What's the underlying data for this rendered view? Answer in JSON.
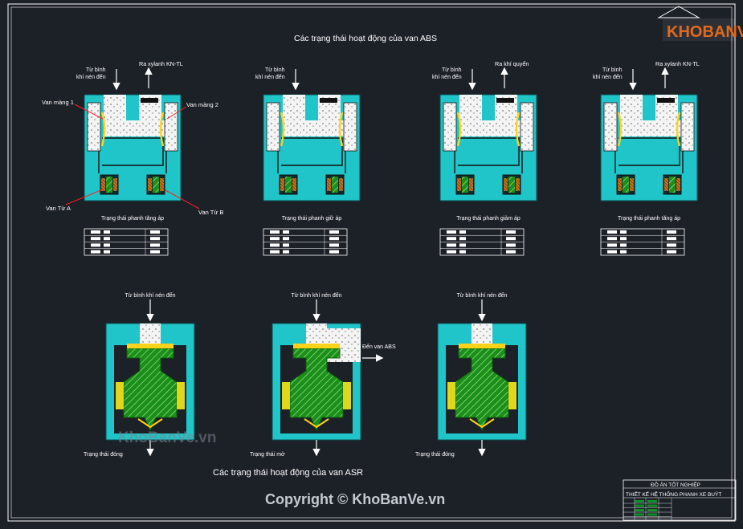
{
  "titles": {
    "abs": "Các trạng thái hoạt động của van ABS",
    "asr": "Các trạng thái hoạt động của van ASR"
  },
  "logo": {
    "text": "KHOBANVE"
  },
  "watermark": {
    "site": "KhoBanVe.vn"
  },
  "copyright": "Copyright © KhoBanVe.vn",
  "abs": {
    "inlet_label_1": "Từ bình",
    "inlet_label_2": "khí nén đến",
    "diagrams": [
      {
        "outlet": "Ra xylanh KN-TL",
        "state": "Trạng thái phanh tăng áp"
      },
      {
        "outlet": "",
        "state": "Trạng thái phanh giữ áp"
      },
      {
        "outlet": "Ra khí quyển",
        "state": "Trạng thái phanh giảm áp"
      },
      {
        "outlet": "Ra xylanh KN-TL",
        "state": "Trạng thái phanh tăng áp"
      }
    ],
    "callouts": {
      "van_mang_1": "Van màng 1",
      "van_mang_2": "Van màng 2",
      "van_tu_a": "Van Từ A",
      "van_tu_b": "Van Từ B"
    }
  },
  "asr": {
    "inlet": "Từ bình khí nén đến",
    "to_abs": "Đến van ABS",
    "states": [
      "Trạng thái đóng",
      "Trạng thái mở",
      "Trạng thái đóng"
    ]
  },
  "titleblock": {
    "line1": "ĐỒ ÁN TỐT NGHIỆP",
    "line2": "THIẾT KẾ HỆ THỐNG PHANH XE BUÝT"
  }
}
